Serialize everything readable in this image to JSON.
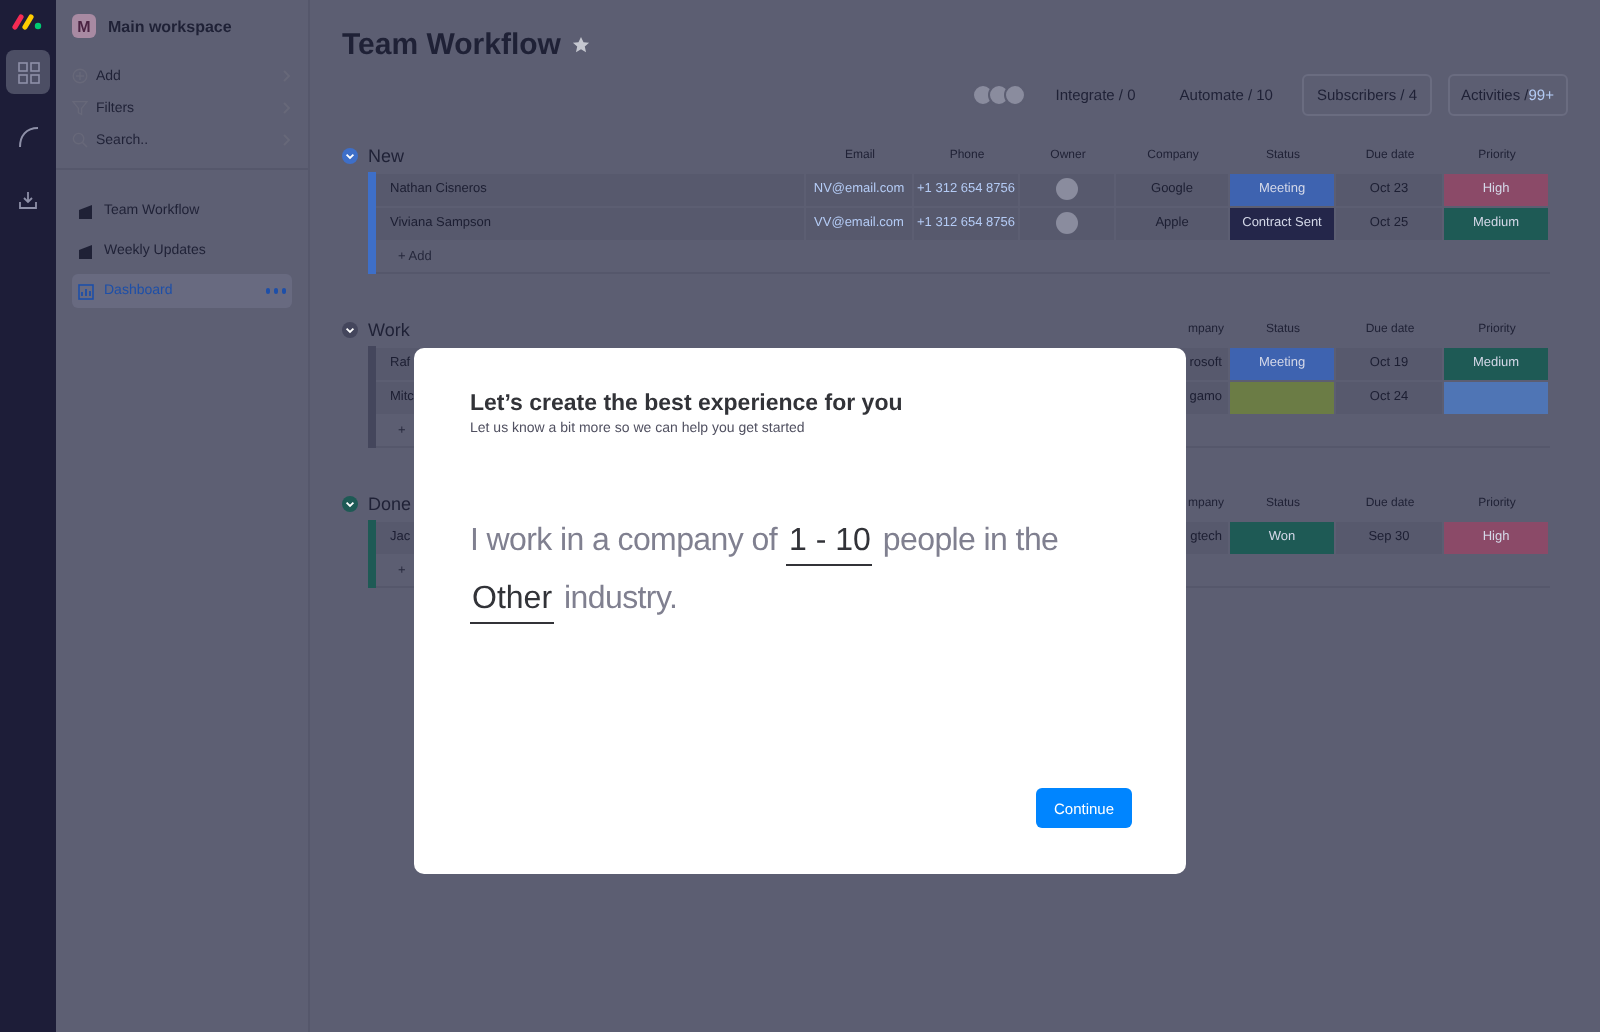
{
  "rail": {
    "items": [
      {
        "selected": true
      },
      {
        "selected": false
      },
      {
        "selected": false
      }
    ]
  },
  "sidebar": {
    "workspace": {
      "initial": "M",
      "name": "Main workspace"
    },
    "menu": [
      {
        "label": "Add"
      },
      {
        "label": "Filters"
      },
      {
        "label": "Search.."
      }
    ],
    "boards": [
      {
        "kind": "board",
        "label": "Team Workflow",
        "selected": false
      },
      {
        "kind": "board",
        "label": "Weekly Updates",
        "selected": false
      },
      {
        "kind": "dashboard",
        "label": "Dashboard",
        "selected": true
      }
    ]
  },
  "board": {
    "title": "Team Workflow",
    "starred": false,
    "actions": [
      {
        "label": "Integrate / 0",
        "outlined": false
      },
      {
        "label": "Automate / 10",
        "outlined": false
      },
      {
        "label": "Subscribers / 4",
        "outlined": true
      },
      {
        "label": "Activities /",
        "count": "99+",
        "outlined": true
      }
    ],
    "groups": [
      {
        "title": "New",
        "color": "#3e6fc8",
        "columns": {
          "email": "Email",
          "phone": "Phone",
          "owner": "Owner",
          "company": "Company",
          "status": "Status",
          "due_date": "Due date",
          "priority": "Priority"
        },
        "rows": [
          {
            "name": "Nathan Cisneros",
            "email": "NV@email.com",
            "phone": "+1 312 654 8756",
            "company": "Google",
            "status": {
              "label": "Meeting",
              "color": "#3e63b0"
            },
            "due_date": "Oct 23",
            "priority": {
              "label": "High",
              "color": "#8b4a68"
            }
          },
          {
            "name": "Viviana Sampson",
            "email": "VV@email.com",
            "phone": "+1 312 654 8756",
            "company": "Apple",
            "status": {
              "label": "Contract Sent",
              "color": "#24264a"
            },
            "due_date": "Oct 25",
            "priority": {
              "label": "Medium",
              "color": "#1e5a55"
            }
          }
        ],
        "add_label": "+ Add"
      },
      {
        "title": "Work",
        "color": "#44465c",
        "columns": {
          "company": "mpany",
          "status": "Status",
          "due_date": "Due date",
          "priority": "Priority"
        },
        "rows": [
          {
            "name": "Raf",
            "company": "rosoft",
            "status": {
              "label": "Meeting",
              "color": "#3e63b0"
            },
            "due_date": "Oct 19",
            "priority": {
              "label": "Medium",
              "color": "#1e5a55"
            }
          },
          {
            "name": "Mitc",
            "company": "gamo",
            "status": {
              "color": "#6b7c45"
            },
            "due_date": "Oct 24",
            "priority": {
              "color": "#4f75b5"
            }
          }
        ],
        "add_label": "+"
      },
      {
        "title": "Done",
        "color": "#1e5a55",
        "columns": {
          "company": "mpany",
          "status": "Status",
          "due_date": "Due date",
          "priority": "Priority"
        },
        "rows": [
          {
            "name": "Jac",
            "company": "gtech",
            "status": {
              "label": "Won",
              "color": "#1e5a55"
            },
            "due_date": "Sep 30",
            "priority": {
              "label": "High",
              "color": "#8b4a68"
            }
          }
        ],
        "add_label": "+"
      }
    ]
  },
  "modal": {
    "title": "Let’s create the best experience for you",
    "subtitle": "Let us know a bit more so we can help you get started",
    "lines": [
      [
        {
          "kind": "text",
          "text": "I work in a company of"
        },
        {
          "kind": "choice",
          "text": "1 - 10"
        },
        {
          "kind": "text",
          "text": "people in the"
        }
      ],
      [
        {
          "kind": "choice",
          "text": "Other"
        },
        {
          "kind": "text",
          "text": "industry."
        }
      ]
    ],
    "button": "Continue"
  }
}
